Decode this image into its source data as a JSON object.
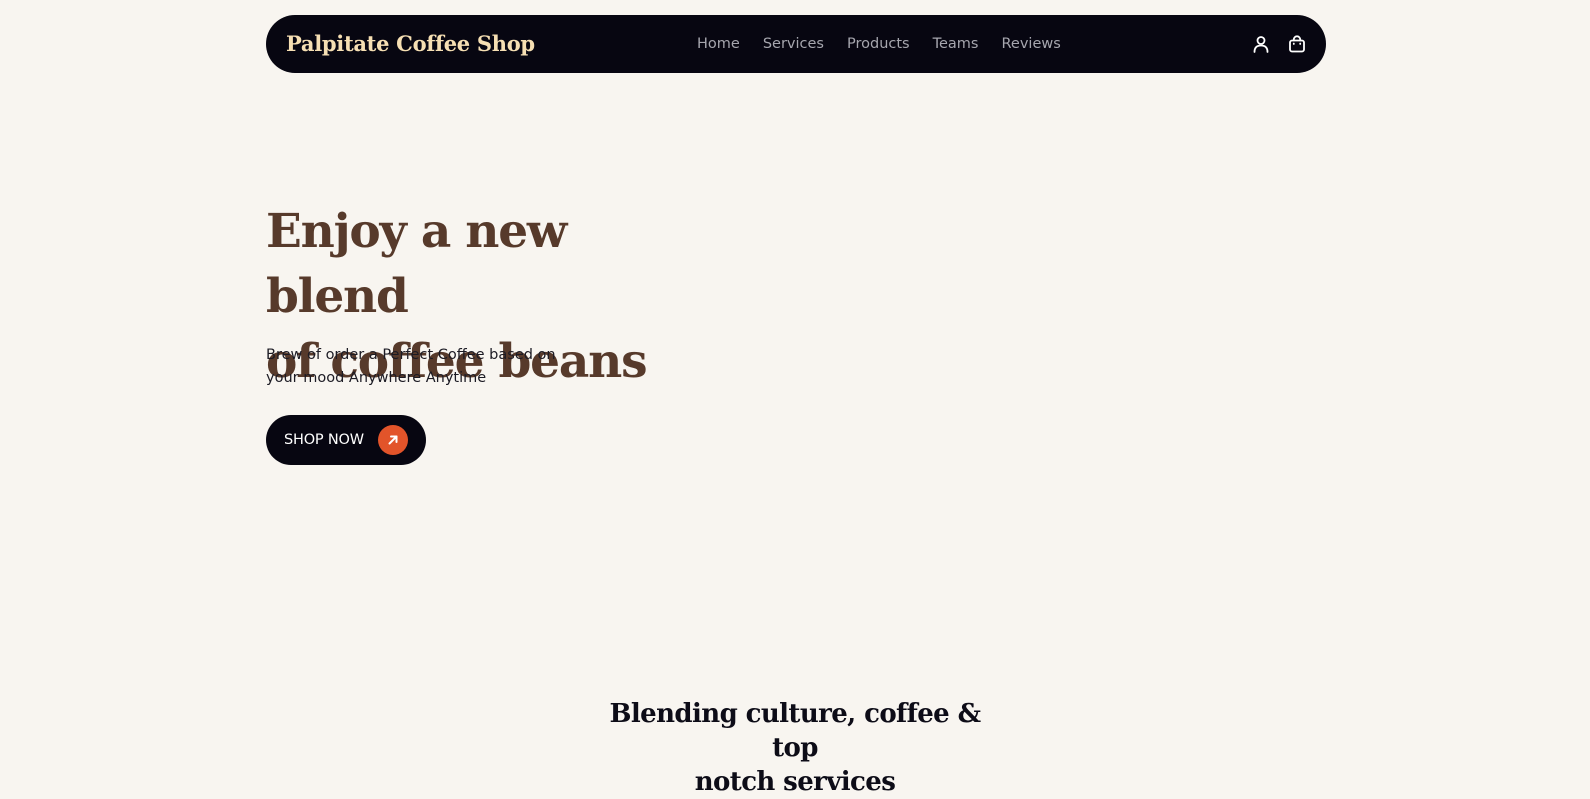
{
  "colors": {
    "page_background": "#f8f5f0",
    "navbar_background": "#070611",
    "brand_text": "#f6dfb3",
    "nav_link_text": "#a6a6ae",
    "hero_title": "#573a2b",
    "body_text": "#1c1b24",
    "accent": "#e2542a",
    "button_background": "#070611"
  },
  "navbar": {
    "brand": "Palpitate Coffee Shop",
    "links": [
      {
        "label": "Home"
      },
      {
        "label": "Services"
      },
      {
        "label": "Products"
      },
      {
        "label": "Teams"
      },
      {
        "label": "Reviews"
      }
    ],
    "icons": [
      "user-icon",
      "shopping-bag-icon"
    ]
  },
  "hero": {
    "title_line1": "Enjoy a new blend",
    "title_line2": "of coffee beans",
    "subtitle_line1": "Brew of order a Perfect Coffee based on",
    "subtitle_line2": "your mood Anywhere Anytime",
    "cta_label": "SHOP NOW",
    "cta_icon": "arrow-up-right-icon"
  },
  "section": {
    "heading_line1": "Blending culture, coffee & top",
    "heading_line2": "notch services"
  }
}
